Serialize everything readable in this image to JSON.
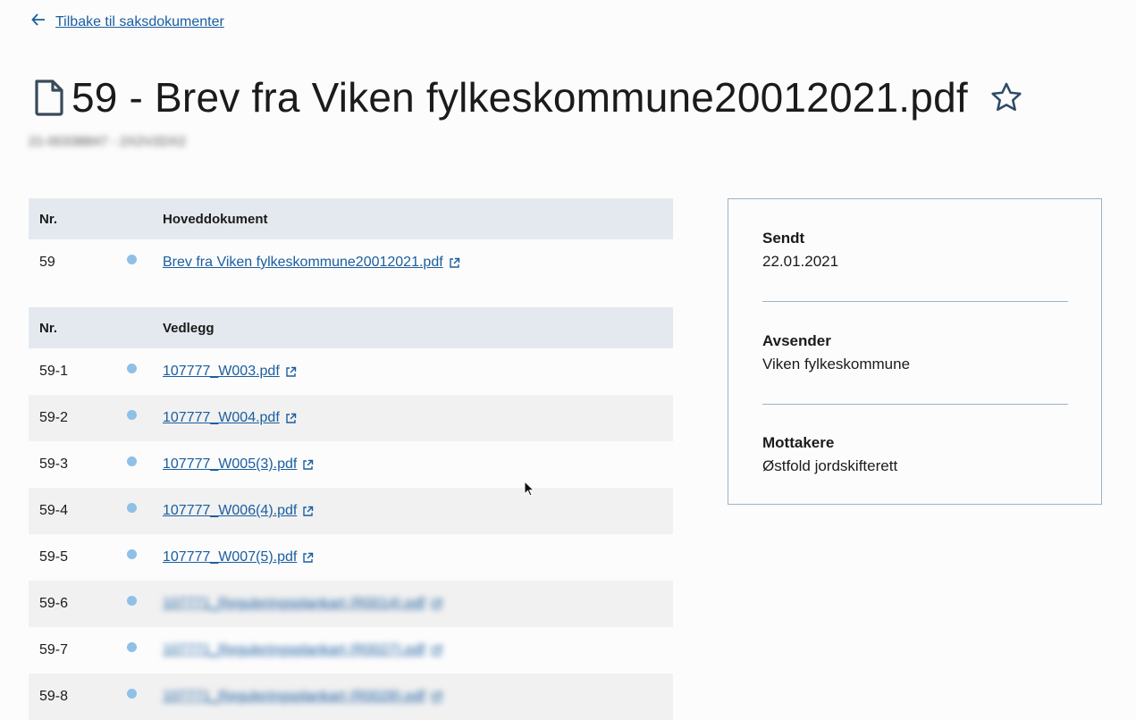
{
  "back_link": {
    "label": "Tilbake til saksdokumenter",
    "icon": "arrow-left-icon"
  },
  "document": {
    "title": "59 - Brev fra Viken fylkeskommune20012021.pdf",
    "case_id": "21-00338847 - 2X2V2DX2",
    "icon": "document-icon",
    "favorite_icon": "star-outline-icon"
  },
  "main_table": {
    "col_nr": "Nr.",
    "col_doc": "Hoveddokument",
    "rows": [
      {
        "nr": "59",
        "name": "Brev fra Viken fylkeskommune20012021.pdf"
      }
    ]
  },
  "attachments_table": {
    "col_nr": "Nr.",
    "col_doc": "Vedlegg",
    "rows": [
      {
        "nr": "59-1",
        "name": "107777_W003.pdf"
      },
      {
        "nr": "59-2",
        "name": "107777_W004.pdf"
      },
      {
        "nr": "59-3",
        "name": "107777_W005(3).pdf"
      },
      {
        "nr": "59-4",
        "name": "107777_W006(4).pdf"
      },
      {
        "nr": "59-5",
        "name": "107777_W007(5).pdf"
      },
      {
        "nr": "59-6",
        "name": "107771_Reguleringsplankart (R0014).pdf"
      },
      {
        "nr": "59-7",
        "name": "107771_Reguleringsplankart (R0027).pdf"
      },
      {
        "nr": "59-8",
        "name": "107771_Reguleringsplankart (R0028).pdf"
      }
    ]
  },
  "info_panel": {
    "sent_label": "Sendt",
    "sent_value": "22.01.2021",
    "sender_label": "Avsender",
    "sender_value": "Viken fylkeskommune",
    "recipients_label": "Mottakere",
    "recipients_value": "Østfold jordskifterett"
  },
  "colors": {
    "link": "#1a5ea0",
    "header_bg": "#e4e9ef",
    "dot": "#8fc0e6",
    "border": "#9eb2c8"
  }
}
